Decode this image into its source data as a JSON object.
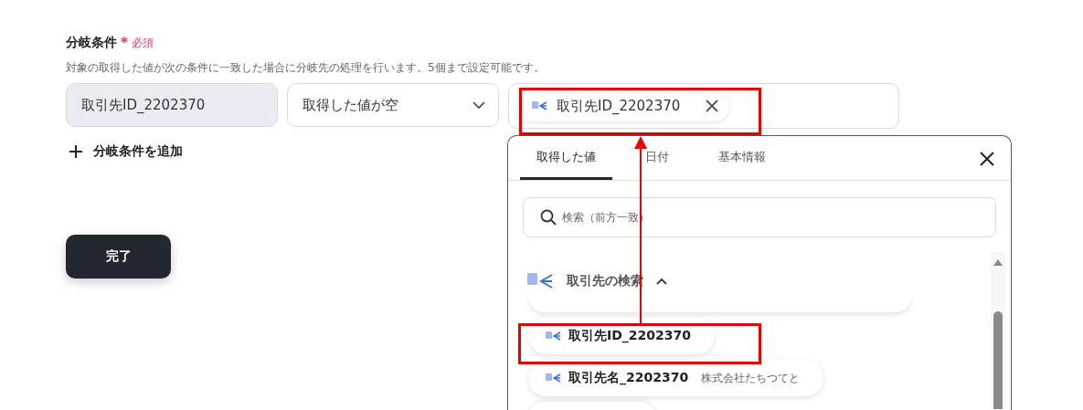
{
  "field": {
    "title": "分岐条件",
    "required_mark": "*",
    "required_label": "必須",
    "description": "対象の取得した値が次の条件に一致した場合に分岐先の処理を行います。5個まで設定可能です。",
    "condition": {
      "target": "取引先ID_2202370",
      "operator": "取得した値が空",
      "value_chip": "取引先ID_2202370"
    },
    "add_button": "分岐条件を追加",
    "done_button": "完了"
  },
  "picker": {
    "tabs": [
      {
        "label": "取得した値",
        "selected": true
      },
      {
        "label": "日付",
        "selected": false
      },
      {
        "label": "基本情報",
        "selected": false
      }
    ],
    "search": {
      "placeholder": "検索（前方一致）"
    },
    "group": {
      "title": "取引先の検索",
      "expanded": true,
      "items": [
        {
          "name": "取引先ID_2202370"
        },
        {
          "name": "取引先名_2202370",
          "value": "株式会社たちつてと"
        }
      ]
    }
  }
}
